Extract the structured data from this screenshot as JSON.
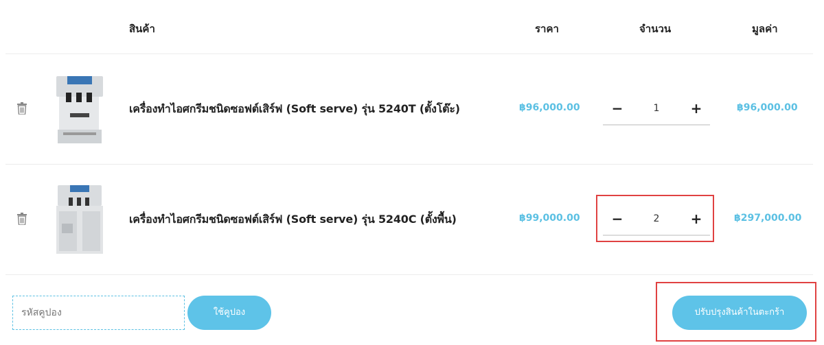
{
  "table": {
    "headers": {
      "product": "สินค้า",
      "price": "ราคา",
      "quantity": "จำนวน",
      "subtotal": "มูลค่า"
    },
    "rows": [
      {
        "name": "เครื่องทำไอศกรีมชนิดซอฟต์เสิร์ฟ (Soft serve) รุ่น 5240T (ตั้งโต๊ะ)",
        "price": "฿96,000.00",
        "quantity": "1",
        "subtotal": "฿96,000.00",
        "minus": "−",
        "plus": "+"
      },
      {
        "name": "เครื่องทำไอศกรีมชนิดซอฟต์เสิร์ฟ (Soft serve) รุ่น 5240C (ตั้งพื้น)",
        "price": "฿99,000.00",
        "quantity": "2",
        "subtotal": "฿297,000.00",
        "minus": "−",
        "plus": "+"
      }
    ]
  },
  "coupon": {
    "placeholder": "รหัสคูปอง",
    "apply_label": "ใช้คูปอง"
  },
  "update_cart_label": "ปรับปรุงสินค้าในตะกร้า",
  "icons": {
    "remove": "trash-icon",
    "thumbnail": "ice-cream-machine"
  },
  "colors": {
    "accent": "#5bc0e3",
    "button": "#5ec3e8",
    "highlight": "#e04141"
  }
}
